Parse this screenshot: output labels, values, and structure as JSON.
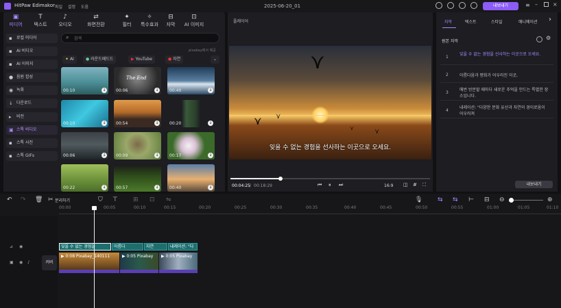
{
  "app": {
    "title": "HitPaw Edimakor",
    "menu": [
      "파일",
      "설정",
      "도움"
    ],
    "project_name": "2025-06-20_01",
    "export_label": "내보내기"
  },
  "toolbar": {
    "tools": [
      {
        "label": "미디어",
        "icon": "media-icon"
      },
      {
        "label": "텍스트",
        "icon": "text-icon"
      },
      {
        "label": "오디오",
        "icon": "audio-icon"
      },
      {
        "label": "화면전환",
        "icon": "transition-icon"
      },
      {
        "label": "필터",
        "icon": "filter-icon"
      },
      {
        "label": "특수효과",
        "icon": "effects-icon"
      },
      {
        "label": "자막",
        "icon": "subtitle-icon"
      },
      {
        "label": "AI 이미지",
        "icon": "ai-image-icon"
      }
    ]
  },
  "sidebar": {
    "items": [
      "로컬 미디어",
      "AI 비디오",
      "AI 이미지",
      "음원 합성",
      "녹화",
      "다운로드",
      "비전",
      "스톡 비디오",
      "스톡 사진",
      "스톡 GIFs"
    ]
  },
  "search": {
    "placeholder": "검색"
  },
  "media": {
    "source_label": "pixabay에서 제공",
    "chips": [
      "AI",
      "라운드패드드",
      "YouTube",
      "자연"
    ],
    "thumbs": [
      {
        "duration": "00:10"
      },
      {
        "duration": "00:06"
      },
      {
        "duration": "00:40"
      },
      {
        "duration": "00:10"
      },
      {
        "duration": "00:54"
      },
      {
        "duration": "00:20"
      },
      {
        "duration": "00:06"
      },
      {
        "duration": "00:09"
      },
      {
        "duration": "00:17"
      },
      {
        "duration": "00:22"
      },
      {
        "duration": "00:57"
      },
      {
        "duration": "00:40"
      }
    ],
    "thumb_text": "The End"
  },
  "player": {
    "title": "플레이어",
    "caption": "잊을 수 없는 경험을 선사하는 이곳으로 오세요.",
    "current_time": "00:04:25",
    "total_time": "00:18:29",
    "aspect": "16:9",
    "progress": 0.25
  },
  "subtitles": {
    "tabs": [
      "자막",
      "텍스트",
      "스타일",
      "애니메이션"
    ],
    "header": "원본 자막",
    "rows": [
      {
        "num": "1",
        "text": "잊을 수 없는 경험을 선사하는 이곳으로 오세요."
      },
      {
        "num": "2",
        "text": "아름다움과 평화가 어우러진 이곳,"
      },
      {
        "num": "3",
        "text": "매번 방문할 때마다 새로운 추억을 만드는 특별한 장소입니다."
      },
      {
        "num": "4",
        "text": "내레이션: \"다양한 문화 유산과 자연의 경이로움이 어우러져"
      }
    ],
    "export_label": "내보내기"
  },
  "timeline": {
    "split_label": "분리하기",
    "ticks": [
      "00:00",
      "00:05",
      "00:10",
      "00:15",
      "00:20",
      "00:25",
      "00:30",
      "00:35",
      "00:40",
      "00:45",
      "00:50",
      "00:55",
      "01:00",
      "01:05",
      "01:10"
    ],
    "subtitle_clips": [
      "잊을 수 없는 경험을",
      "아름다",
      "자연",
      "내레이션: \"다"
    ],
    "cover_label": "커버",
    "video_clips": [
      {
        "label": "0:08 Pixabay_140111"
      },
      {
        "label": "0:05 Pixabay"
      },
      {
        "label": "0:05 Pixabay"
      }
    ]
  },
  "colors": {
    "accent": "#8b5cf6",
    "subtitle_clip": "#1f6e6e",
    "video_bar": "#5b3fb2"
  }
}
